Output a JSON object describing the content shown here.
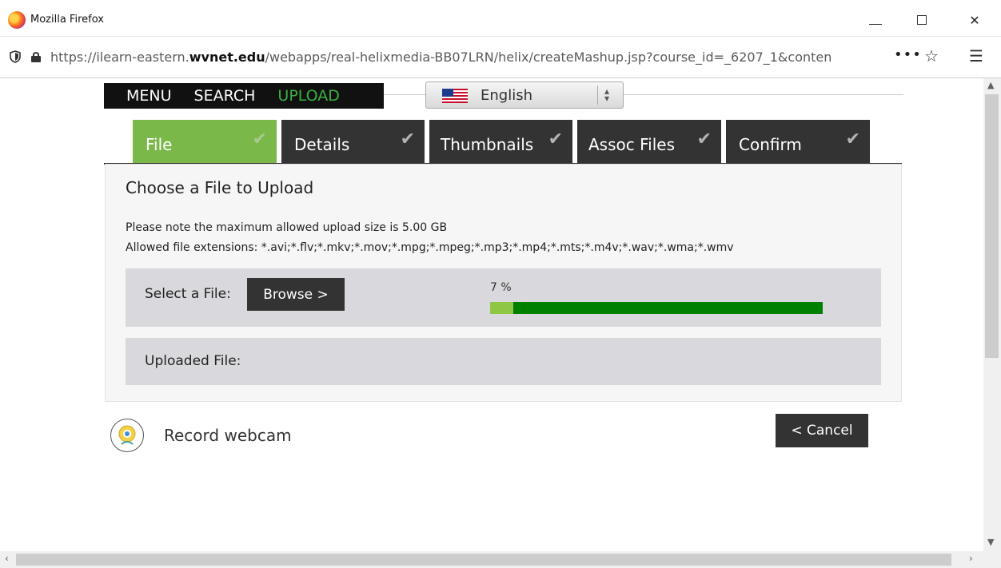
{
  "window": {
    "title": "Mozilla Firefox"
  },
  "browser": {
    "url_prefix": "https://ilearn-eastern.",
    "url_domain": "wvnet.edu",
    "url_suffix": "/webapps/real-helixmedia-BB07LRN/helix/createMashup.jsp?course_id=_6207_1&conten",
    "more_label": "•••",
    "bookmark_icon": "star-icon",
    "menu_icon": "hamburger-icon"
  },
  "topnav": {
    "items": [
      "MENU",
      "SEARCH",
      "UPLOAD"
    ],
    "active_color": "#3cb043"
  },
  "language": {
    "selected": "English",
    "flag_icon": "us-flag-icon"
  },
  "tabs": [
    {
      "label": "File",
      "active": true
    },
    {
      "label": "Details",
      "active": false
    },
    {
      "label": "Thumbnails",
      "active": false
    },
    {
      "label": "Assoc Files",
      "active": false
    },
    {
      "label": "Confirm",
      "active": false
    }
  ],
  "panel": {
    "heading": "Choose a File to Upload",
    "note_size": "Please note the maximum allowed upload size is 5.00 GB",
    "note_extensions": "Allowed file extensions: *.avi;*.flv;*.mkv;*.mov;*.mpg;*.mpeg;*.mp3;*.mp4;*.mts;*.m4v;*.wav;*.wma;*.wmv",
    "select_label": "Select a File:",
    "browse_label": "Browse >",
    "progress_text": "7 %",
    "progress_fraction": 0.07,
    "uploaded_label": "Uploaded File:"
  },
  "footer": {
    "webcam_label": "Record webcam",
    "cancel_label": "< Cancel"
  },
  "colors": {
    "tab_active": "#7ab84a",
    "tab_inactive": "#333333",
    "progress_track": "#008000",
    "progress_fill": "#8fc744"
  }
}
